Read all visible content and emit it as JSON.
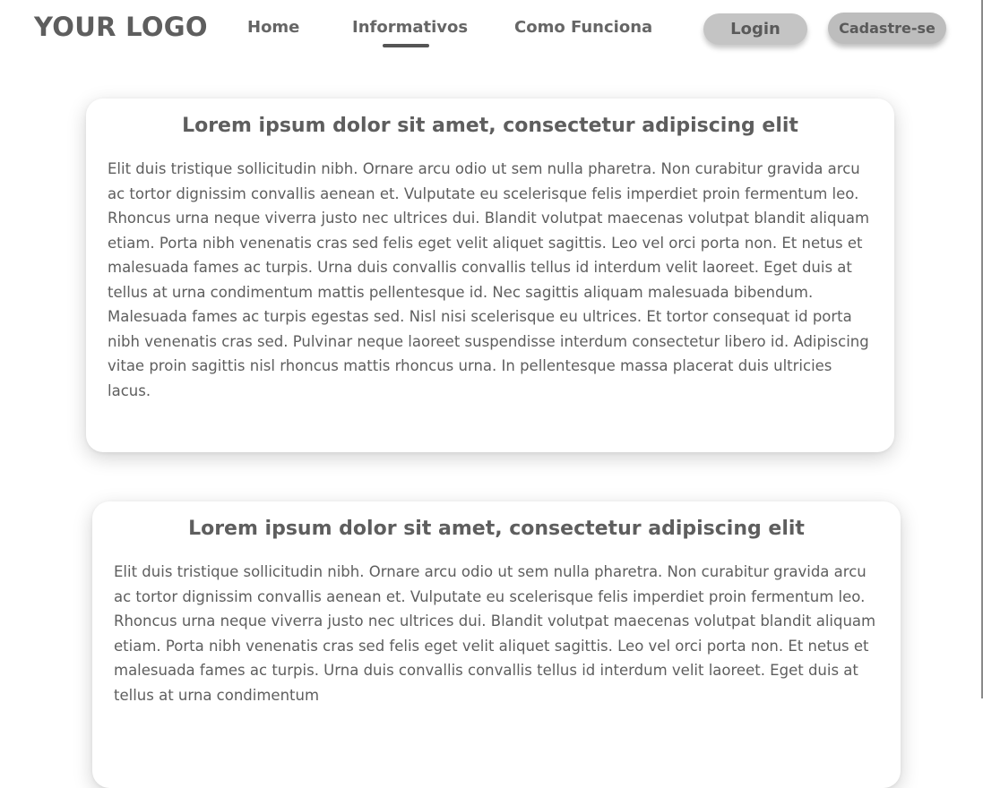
{
  "header": {
    "logo": "YOUR LOGO",
    "nav": {
      "home": "Home",
      "informativos": "Informativos",
      "como_funciona": "Como Funciona"
    },
    "login_label": "Login",
    "signup_label": "Cadastre-se"
  },
  "articles": [
    {
      "title": "Lorem ipsum dolor sit amet, consectetur adipiscing elit",
      "body": "Elit duis tristique sollicitudin nibh. Ornare arcu odio ut sem nulla pharetra. Non curabitur gravida arcu ac tortor dignissim convallis aenean et. Vulputate eu scelerisque felis imperdiet proin fermentum leo. Rhoncus urna neque viverra justo nec ultrices dui. Blandit volutpat maecenas volutpat blandit aliquam etiam. Porta nibh venenatis cras sed felis eget velit aliquet sagittis. Leo vel orci porta non. Et netus et malesuada fames ac turpis. Urna duis convallis convallis tellus id interdum velit laoreet. Eget duis at tellus at urna condimentum mattis pellentesque id. Nec sagittis aliquam malesuada bibendum. Malesuada fames ac turpis egestas sed. Nisl nisi scelerisque eu ultrices. Et tortor consequat id porta nibh venenatis cras sed. Pulvinar neque laoreet suspendisse interdum consectetur libero id. Adipiscing vitae proin sagittis nisl rhoncus mattis rhoncus urna. In pellentesque massa placerat duis ultricies lacus."
    },
    {
      "title": "Lorem ipsum dolor sit amet, consectetur adipiscing elit",
      "body": "Elit duis tristique sollicitudin nibh. Ornare arcu odio ut sem nulla pharetra. Non curabitur gravida arcu ac tortor dignissim convallis aenean et. Vulputate eu scelerisque felis imperdiet proin fermentum leo. Rhoncus urna neque viverra justo nec ultrices dui. Blandit volutpat maecenas volutpat blandit aliquam etiam. Porta nibh venenatis cras sed felis eget velit aliquet sagittis. Leo vel orci porta non. Et netus et malesuada fames ac turpis. Urna duis convallis convallis tellus id interdum velit laoreet. Eget duis at tellus at urna condimentum"
    }
  ]
}
